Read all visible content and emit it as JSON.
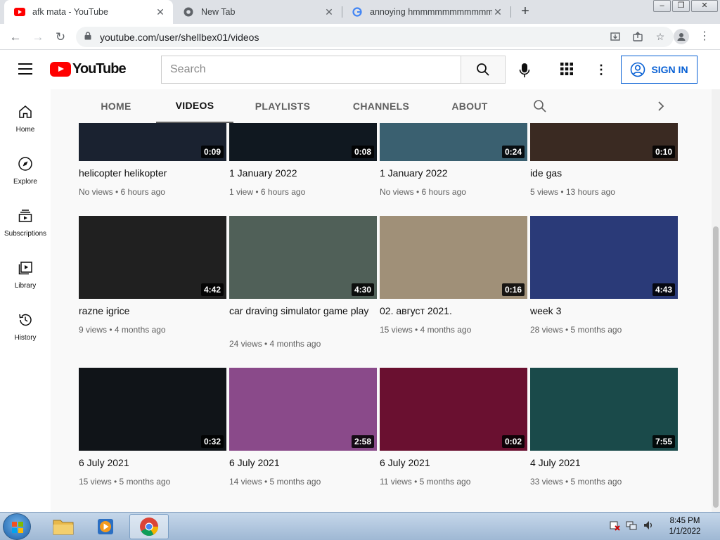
{
  "browser": {
    "tabs": [
      {
        "title": "afk mata - YouTube",
        "active": true
      },
      {
        "title": "New Tab",
        "active": false
      },
      {
        "title": "annoying hmmmmmmmmmmmm",
        "active": false
      }
    ],
    "url": "youtube.com/user/shellbex01/videos"
  },
  "masthead": {
    "logo_text": "YouTube",
    "search_placeholder": "Search",
    "signin_label": "SIGN IN"
  },
  "guide": [
    {
      "label": "Home",
      "icon": "home-icon"
    },
    {
      "label": "Explore",
      "icon": "compass-icon"
    },
    {
      "label": "Subscriptions",
      "icon": "subscriptions-icon"
    },
    {
      "label": "Library",
      "icon": "library-icon"
    },
    {
      "label": "History",
      "icon": "history-icon"
    }
  ],
  "channel_tabs": [
    {
      "label": "HOME",
      "selected": false
    },
    {
      "label": "VIDEOS",
      "selected": true
    },
    {
      "label": "PLAYLISTS",
      "selected": false
    },
    {
      "label": "CHANNELS",
      "selected": false
    },
    {
      "label": "ABOUT",
      "selected": false
    }
  ],
  "videos": [
    {
      "title": "helicopter helikopter",
      "meta": "No views • 6 hours ago",
      "duration": "0:09",
      "thumb": "#1a2230"
    },
    {
      "title": "1 January 2022",
      "meta": "1 view • 6 hours ago",
      "duration": "0:08",
      "thumb": "#101820"
    },
    {
      "title": "1 January 2022",
      "meta": "No views • 6 hours ago",
      "duration": "0:24",
      "thumb": "#3a6070"
    },
    {
      "title": "ide gas",
      "meta": "5 views • 13 hours ago",
      "duration": "0:10",
      "thumb": "#3a2a22"
    },
    {
      "title": "razne igrice",
      "meta": "9 views • 4 months ago",
      "duration": "4:42",
      "thumb": "#202020"
    },
    {
      "title": "car draving simulator game play",
      "meta": "24 views • 4 months ago",
      "duration": "4:30",
      "thumb": "#506058"
    },
    {
      "title": "02. август 2021.",
      "meta": "15 views • 4 months ago",
      "duration": "0:16",
      "thumb": "#a09078"
    },
    {
      "title": "week 3",
      "meta": "28 views • 5 months ago",
      "duration": "4:43",
      "thumb": "#2a3a78"
    },
    {
      "title": "6 July 2021",
      "meta": "15 views • 5 months ago",
      "duration": "0:32",
      "thumb": "#101418"
    },
    {
      "title": "6 July 2021",
      "meta": "14 views • 5 months ago",
      "duration": "2:58",
      "thumb": "#8a4a8a"
    },
    {
      "title": "6 July 2021",
      "meta": "11 views • 5 months ago",
      "duration": "0:02",
      "thumb": "#6a1030"
    },
    {
      "title": "4 July 2021",
      "meta": "33 views • 5 months ago",
      "duration": "7:55",
      "thumb": "#1a4a4a"
    }
  ],
  "taskbar": {
    "time": "8:45 PM",
    "date": "1/1/2022"
  }
}
